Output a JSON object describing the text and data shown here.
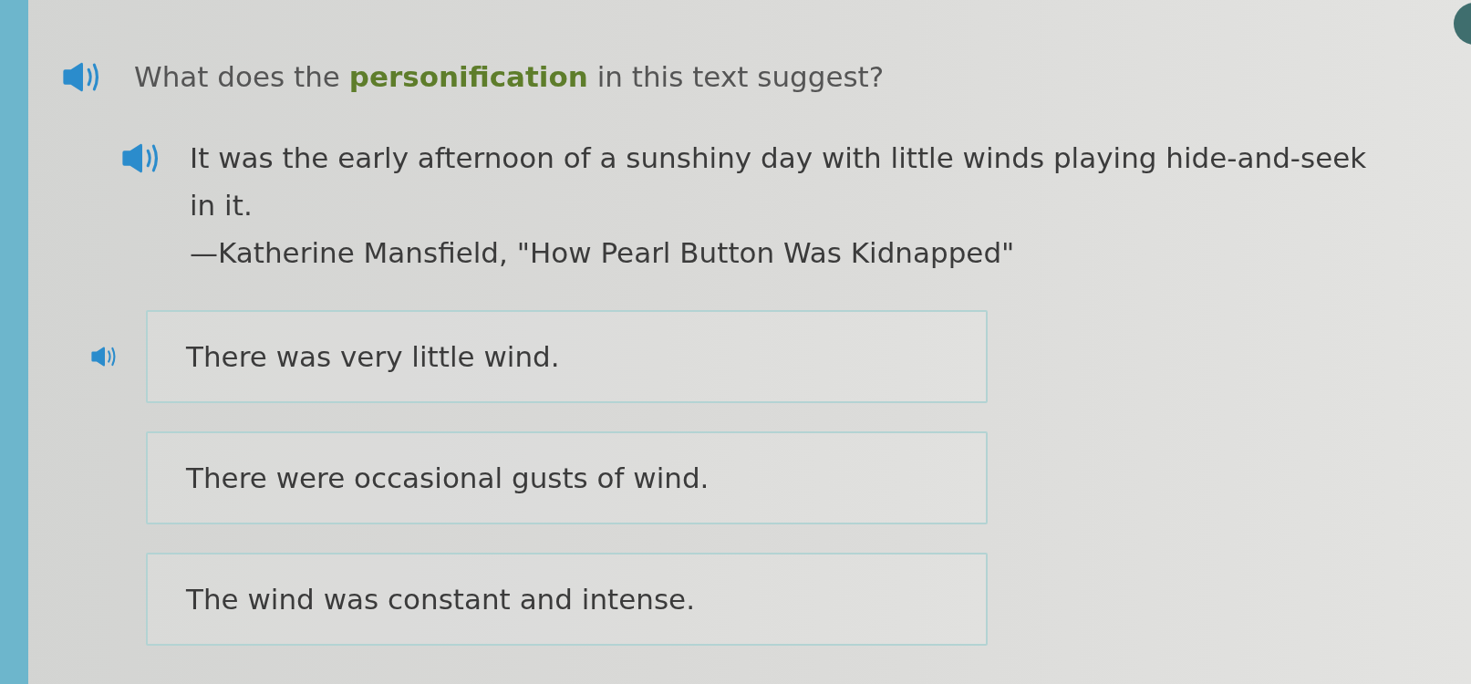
{
  "question": {
    "audio": true,
    "text": "What does the **personification** in this text suggest?"
  },
  "passage": {
    "audio": true,
    "text": "It was the early afternoon of a sunshiny day with little winds playing hide-and-seek in it.",
    "attribution": "—Katherine Mansfield, \"How Pearl Button Was Kidnapped\""
  },
  "choices": [
    {
      "text": "There was very little wind.",
      "audio": true,
      "selected": false
    },
    {
      "text": "There were occasional gusts of wind.",
      "audio": false,
      "selected": false
    },
    {
      "text": "The wind was constant and intense.",
      "audio": false,
      "selected": false
    }
  ]
}
